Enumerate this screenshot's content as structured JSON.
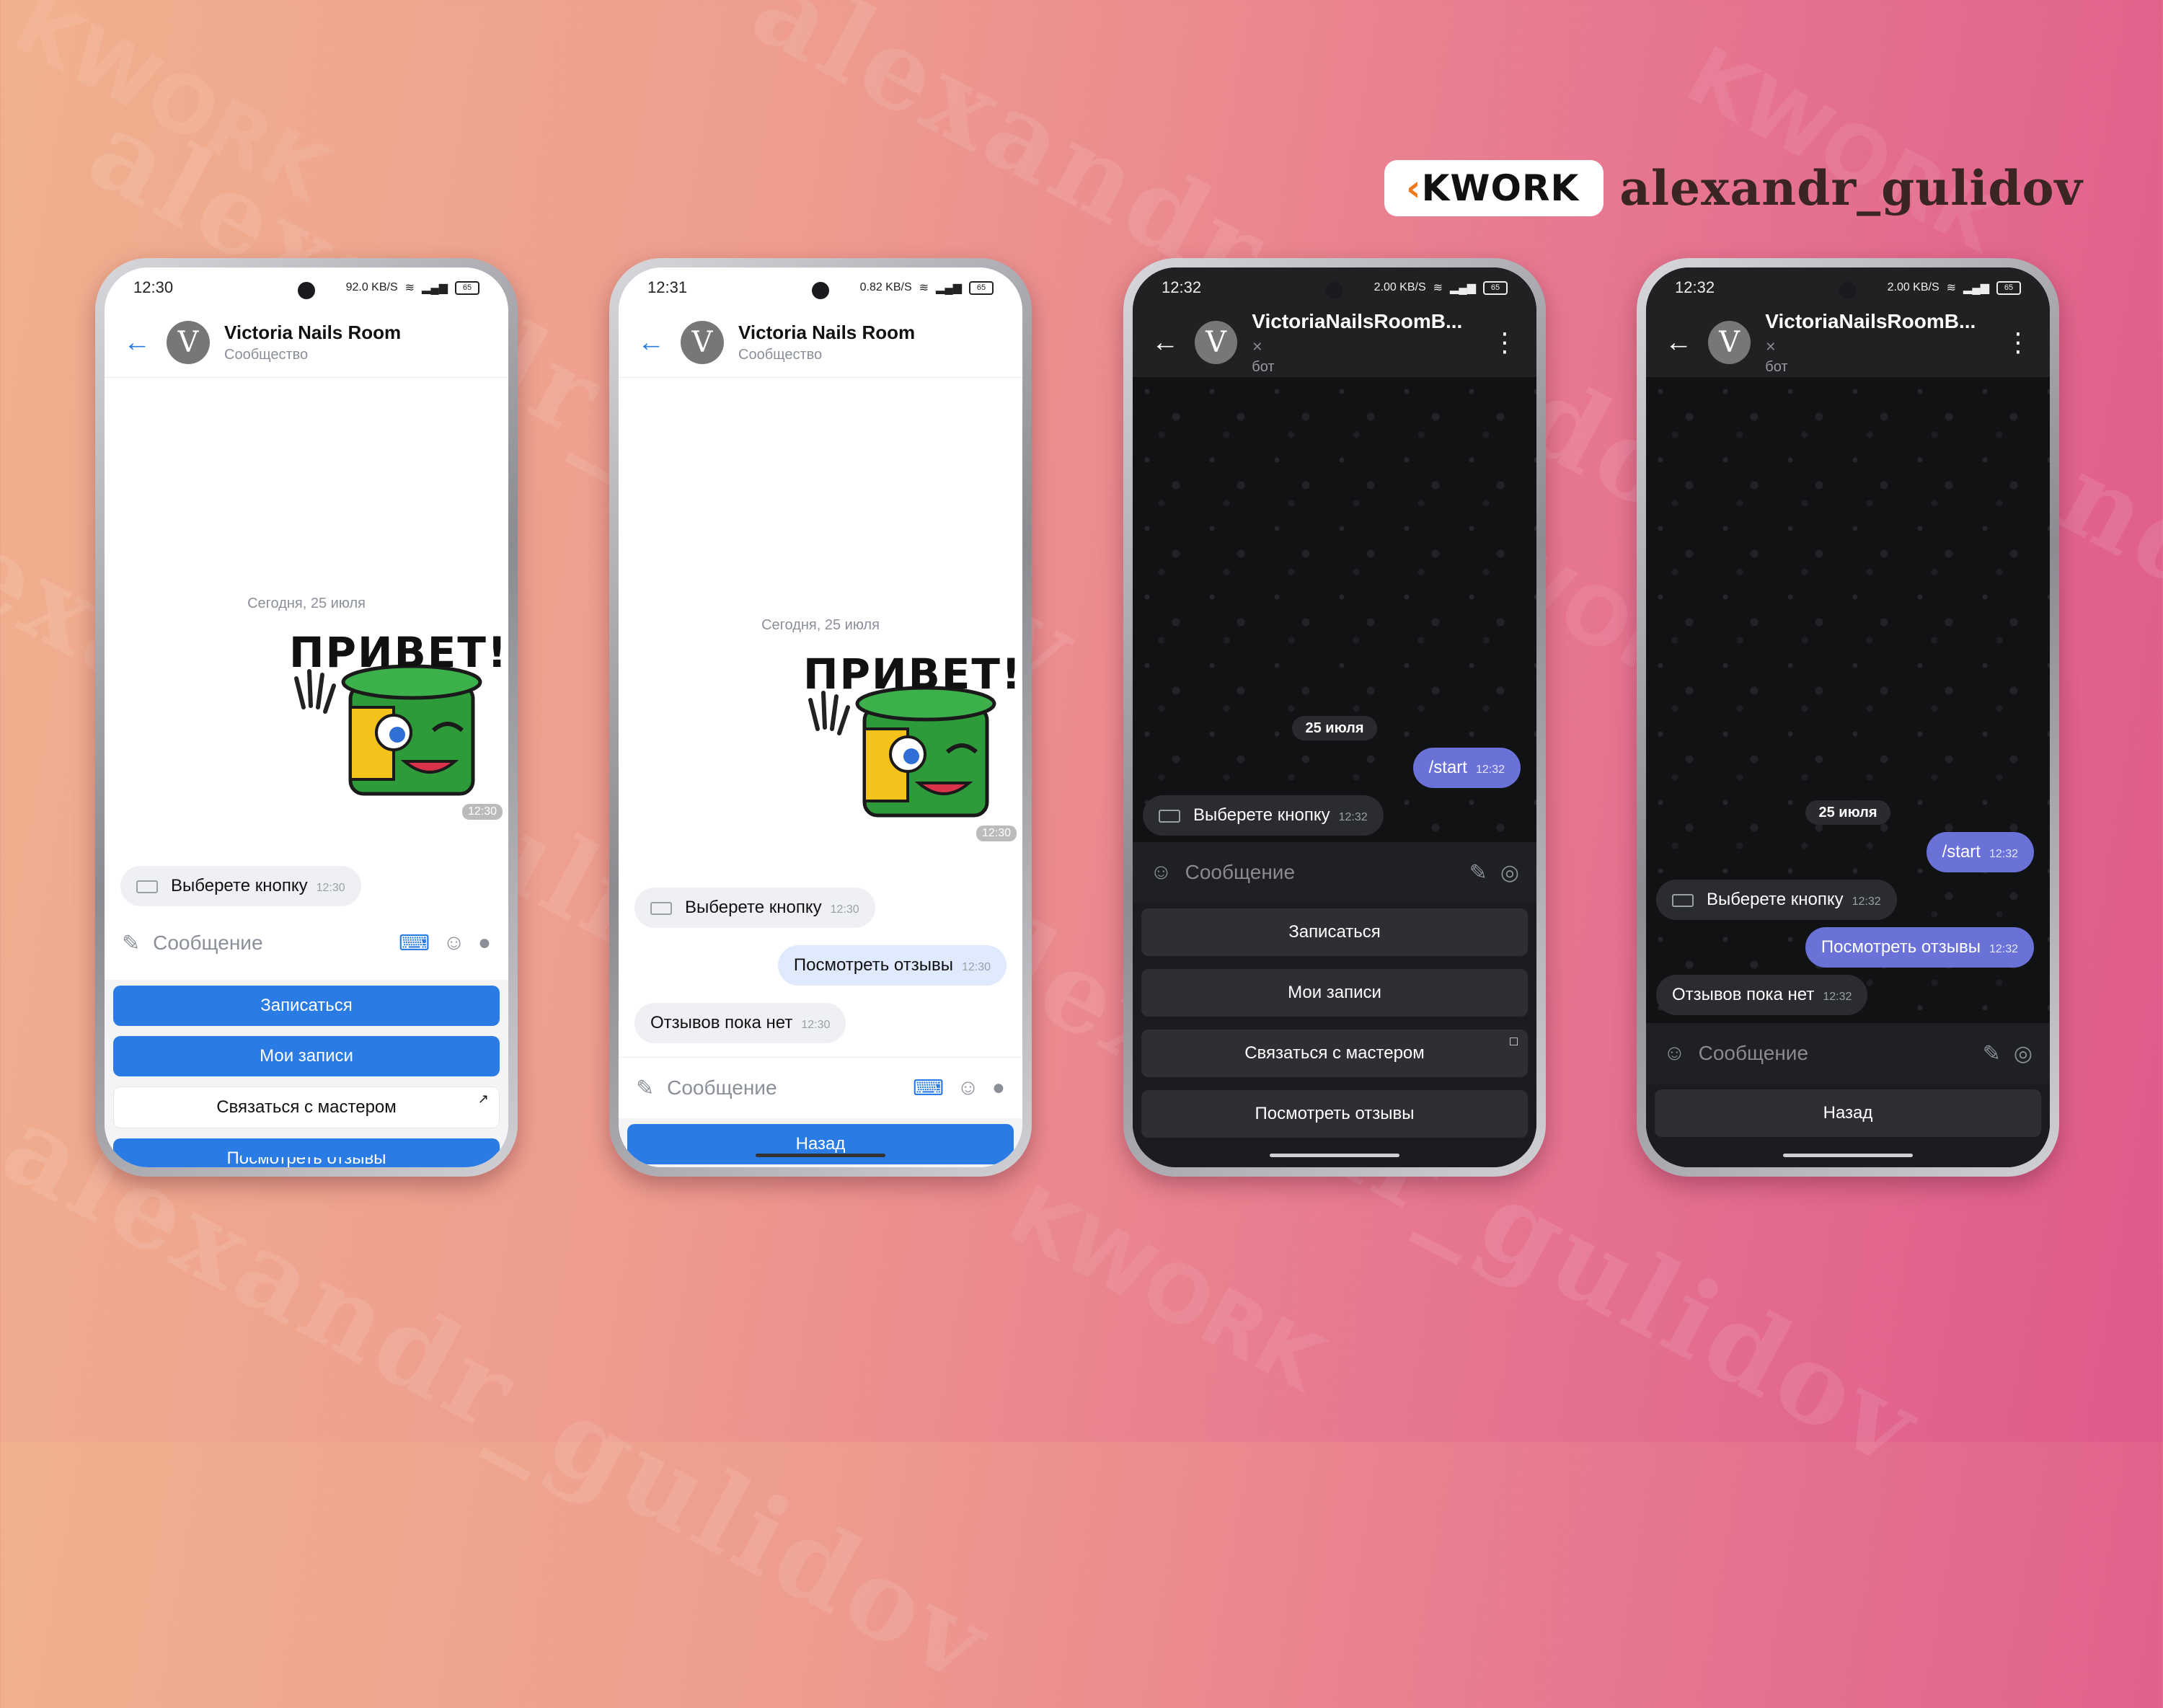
{
  "brand": {
    "logo_text": "KWORK",
    "username": "alexandr_gulidov"
  },
  "watermarks": [
    "alexandr_gulidov",
    "KWORK"
  ],
  "colors": {
    "vk_blue": "#2a7be4",
    "tg_out_bubble": "#6a72d8",
    "tg_dark_bg": "#111214",
    "kwork_orange": "#f07a1a"
  },
  "phone1": {
    "status": {
      "time": "12:30",
      "net": "92.0 KB/S",
      "battery": "65"
    },
    "header": {
      "title": "Victoria Nails Room",
      "subtitle": "Сообщество",
      "back_icon": "←",
      "avatar_letter": "V"
    },
    "date": "Сегодня, 25 июля",
    "sticker": {
      "text": "ПРИВЕТ!",
      "time": "12:30"
    },
    "messages": [
      {
        "text": "Выберете кнопку",
        "time": "12:30"
      }
    ],
    "input_placeholder": "Сообщение",
    "buttons": [
      "Записаться",
      "Мои записи",
      "Связаться с мастером",
      "Посмотреть отзывы"
    ]
  },
  "phone2": {
    "status": {
      "time": "12:31",
      "net": "0.82 KB/S",
      "battery": "65"
    },
    "header": {
      "title": "Victoria Nails Room",
      "subtitle": "Сообщество",
      "back_icon": "←",
      "avatar_letter": "V"
    },
    "date": "Сегодня, 25 июля",
    "sticker": {
      "text": "ПРИВЕТ!",
      "time": "12:30"
    },
    "messages": [
      {
        "text": "Выберете кнопку",
        "time": "12:30"
      },
      {
        "text": "Посмотреть отзывы",
        "time": "12:30"
      },
      {
        "text": "Отзывов пока нет",
        "time": "12:30"
      }
    ],
    "input_placeholder": "Сообщение",
    "buttons": [
      "Назад"
    ]
  },
  "phone3": {
    "status": {
      "time": "12:32",
      "net": "2.00 KB/S",
      "battery": "65"
    },
    "header": {
      "title": "VictoriaNailsRoomB...",
      "subtitle": "бот",
      "back_icon": "←",
      "avatar_letter": "V",
      "menu_icon": "⋮"
    },
    "date": "25 июля",
    "messages": [
      {
        "text": "/start",
        "time": "12:32"
      },
      {
        "text": "Выберете кнопку",
        "time": "12:32"
      }
    ],
    "input_placeholder": "Сообщение",
    "buttons": [
      "Записаться",
      "Мои записи",
      "Связаться с мастером",
      "Посмотреть отзывы"
    ]
  },
  "phone4": {
    "status": {
      "time": "12:32",
      "net": "2.00 KB/S",
      "battery": "65"
    },
    "header": {
      "title": "VictoriaNailsRoomB...",
      "subtitle": "бот",
      "back_icon": "←",
      "avatar_letter": "V",
      "menu_icon": "⋮"
    },
    "date": "25 июля",
    "messages": [
      {
        "text": "/start",
        "time": "12:32"
      },
      {
        "text": "Выберете кнопку",
        "time": "12:32"
      },
      {
        "text": "Посмотреть отзывы",
        "time": "12:32"
      },
      {
        "text": "Отзывов пока нет",
        "time": "12:32"
      }
    ],
    "input_placeholder": "Сообщение",
    "buttons": [
      "Назад"
    ]
  }
}
